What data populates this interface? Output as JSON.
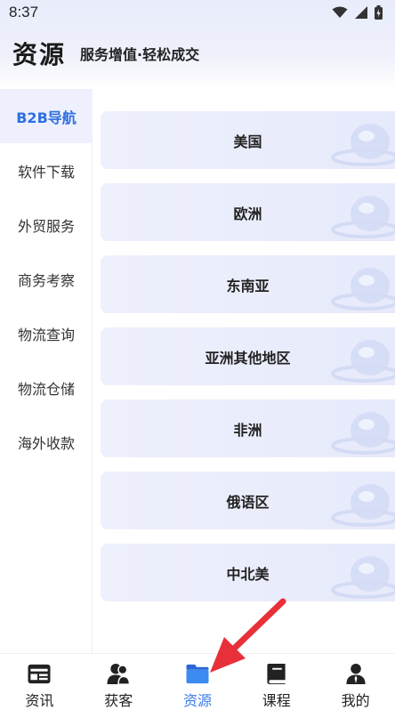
{
  "status_bar": {
    "time": "8:37",
    "icons": [
      "wifi-icon",
      "signal-icon",
      "battery-icon"
    ]
  },
  "header": {
    "title": "资源",
    "slogan": "服务增值·轻松成交"
  },
  "sidebar": {
    "items": [
      {
        "label": "B2B导航",
        "active": true
      },
      {
        "label": "软件下载",
        "active": false
      },
      {
        "label": "外贸服务",
        "active": false
      },
      {
        "label": "商务考察",
        "active": false
      },
      {
        "label": "物流查询",
        "active": false
      },
      {
        "label": "物流仓储",
        "active": false
      },
      {
        "label": "海外收款",
        "active": false
      }
    ]
  },
  "regions": [
    {
      "label": "美国"
    },
    {
      "label": "欧洲"
    },
    {
      "label": "东南亚"
    },
    {
      "label": "亚洲其他地区"
    },
    {
      "label": "非洲"
    },
    {
      "label": "俄语区"
    },
    {
      "label": "中北美"
    }
  ],
  "tabbar": {
    "tabs": [
      {
        "label": "资讯",
        "icon": "news-icon",
        "active": false
      },
      {
        "label": "获客",
        "icon": "users-icon",
        "active": false
      },
      {
        "label": "资源",
        "icon": "folder-icon",
        "active": true
      },
      {
        "label": "课程",
        "icon": "book-icon",
        "active": false
      },
      {
        "label": "我的",
        "icon": "person-icon",
        "active": false
      }
    ]
  },
  "colors": {
    "accent": "#3b7be8",
    "sidebar_active_bg": "#eef1fd",
    "card_bg": "#e9ecfb",
    "annotation_arrow": "#e8303a"
  }
}
